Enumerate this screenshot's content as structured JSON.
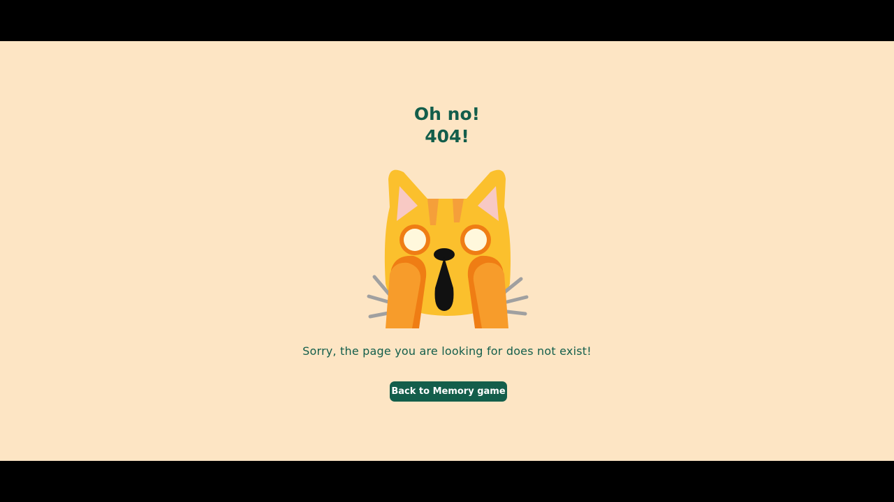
{
  "page": {
    "title_line1": "Oh no!",
    "title_line2": "404!",
    "message": "Sorry, the page you are looking for does not exist!",
    "back_button_label": "Back to Memory game"
  },
  "illustration": {
    "icon": "weary-cat-face-emoji"
  },
  "colors": {
    "background": "#fde5c4",
    "text": "#135e4b",
    "button": "#135e4b",
    "button_text": "#ffffff",
    "letterbox": "#000000"
  }
}
